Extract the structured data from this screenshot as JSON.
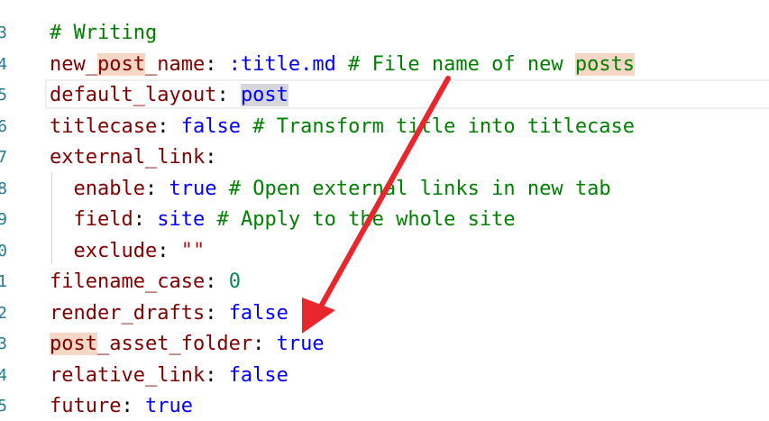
{
  "line_numbers": [
    "3",
    "4",
    "5",
    "6",
    "7",
    "8",
    "9",
    "0",
    "1",
    "2",
    "3",
    "4",
    "5"
  ],
  "lines": [
    [
      {
        "t": "# Writing",
        "c": "c"
      }
    ],
    [
      {
        "t": "new_",
        "c": "k"
      },
      {
        "t": "post",
        "c": "k hl"
      },
      {
        "t": "_name",
        "c": "k"
      },
      {
        "t": ": ",
        "c": "p"
      },
      {
        "t": ":title.md",
        "c": "b"
      },
      {
        "t": " # File name of new ",
        "c": "c"
      },
      {
        "t": "posts",
        "c": "c hl"
      }
    ],
    [
      {
        "t": "default_layout",
        "c": "k"
      },
      {
        "t": ": ",
        "c": "p"
      },
      {
        "t": "post",
        "c": "b sel"
      }
    ],
    [
      {
        "t": "titlecase",
        "c": "k"
      },
      {
        "t": ": ",
        "c": "p"
      },
      {
        "t": "false",
        "c": "b"
      },
      {
        "t": " # Transform title into titlecase",
        "c": "c"
      }
    ],
    [
      {
        "t": "external_link",
        "c": "k"
      },
      {
        "t": ":",
        "c": "p"
      }
    ],
    [
      {
        "t": "  ",
        "c": "p"
      },
      {
        "t": "enable",
        "c": "k"
      },
      {
        "t": ": ",
        "c": "p"
      },
      {
        "t": "true",
        "c": "b"
      },
      {
        "t": " # Open external links in new tab",
        "c": "c"
      }
    ],
    [
      {
        "t": "  ",
        "c": "p"
      },
      {
        "t": "field",
        "c": "k"
      },
      {
        "t": ": ",
        "c": "p"
      },
      {
        "t": "site",
        "c": "b"
      },
      {
        "t": " # Apply to the whole site",
        "c": "c"
      }
    ],
    [
      {
        "t": "  ",
        "c": "p"
      },
      {
        "t": "exclude",
        "c": "k"
      },
      {
        "t": ": ",
        "c": "p"
      },
      {
        "t": "\"\"",
        "c": "s"
      }
    ],
    [
      {
        "t": "filename_case",
        "c": "k"
      },
      {
        "t": ": ",
        "c": "p"
      },
      {
        "t": "0",
        "c": "n"
      }
    ],
    [
      {
        "t": "render_drafts",
        "c": "k"
      },
      {
        "t": ": ",
        "c": "p"
      },
      {
        "t": "false",
        "c": "b"
      }
    ],
    [
      {
        "t": "post",
        "c": "k hl"
      },
      {
        "t": "_asset_folder",
        "c": "k"
      },
      {
        "t": ": ",
        "c": "p"
      },
      {
        "t": "true",
        "c": "b"
      }
    ],
    [
      {
        "t": "relative_link",
        "c": "k"
      },
      {
        "t": ": ",
        "c": "p"
      },
      {
        "t": "false",
        "c": "b"
      }
    ],
    [
      {
        "t": "future",
        "c": "k"
      },
      {
        "t": ": ",
        "c": "p"
      },
      {
        "t": "true",
        "c": "b"
      }
    ]
  ],
  "colors": {
    "key": "#800000",
    "comment": "#008000",
    "value": "#0000ff",
    "number": "#098658",
    "string": "#a31515",
    "find_highlight": "#f6d6c4",
    "selection": "#d6d6dd",
    "arrow": "#e8262b",
    "line_number": "#237893"
  },
  "annotation": {
    "type": "arrow",
    "color": "#e8262b",
    "from_line": "new_post_name",
    "points_to_line": "post_asset_folder"
  }
}
